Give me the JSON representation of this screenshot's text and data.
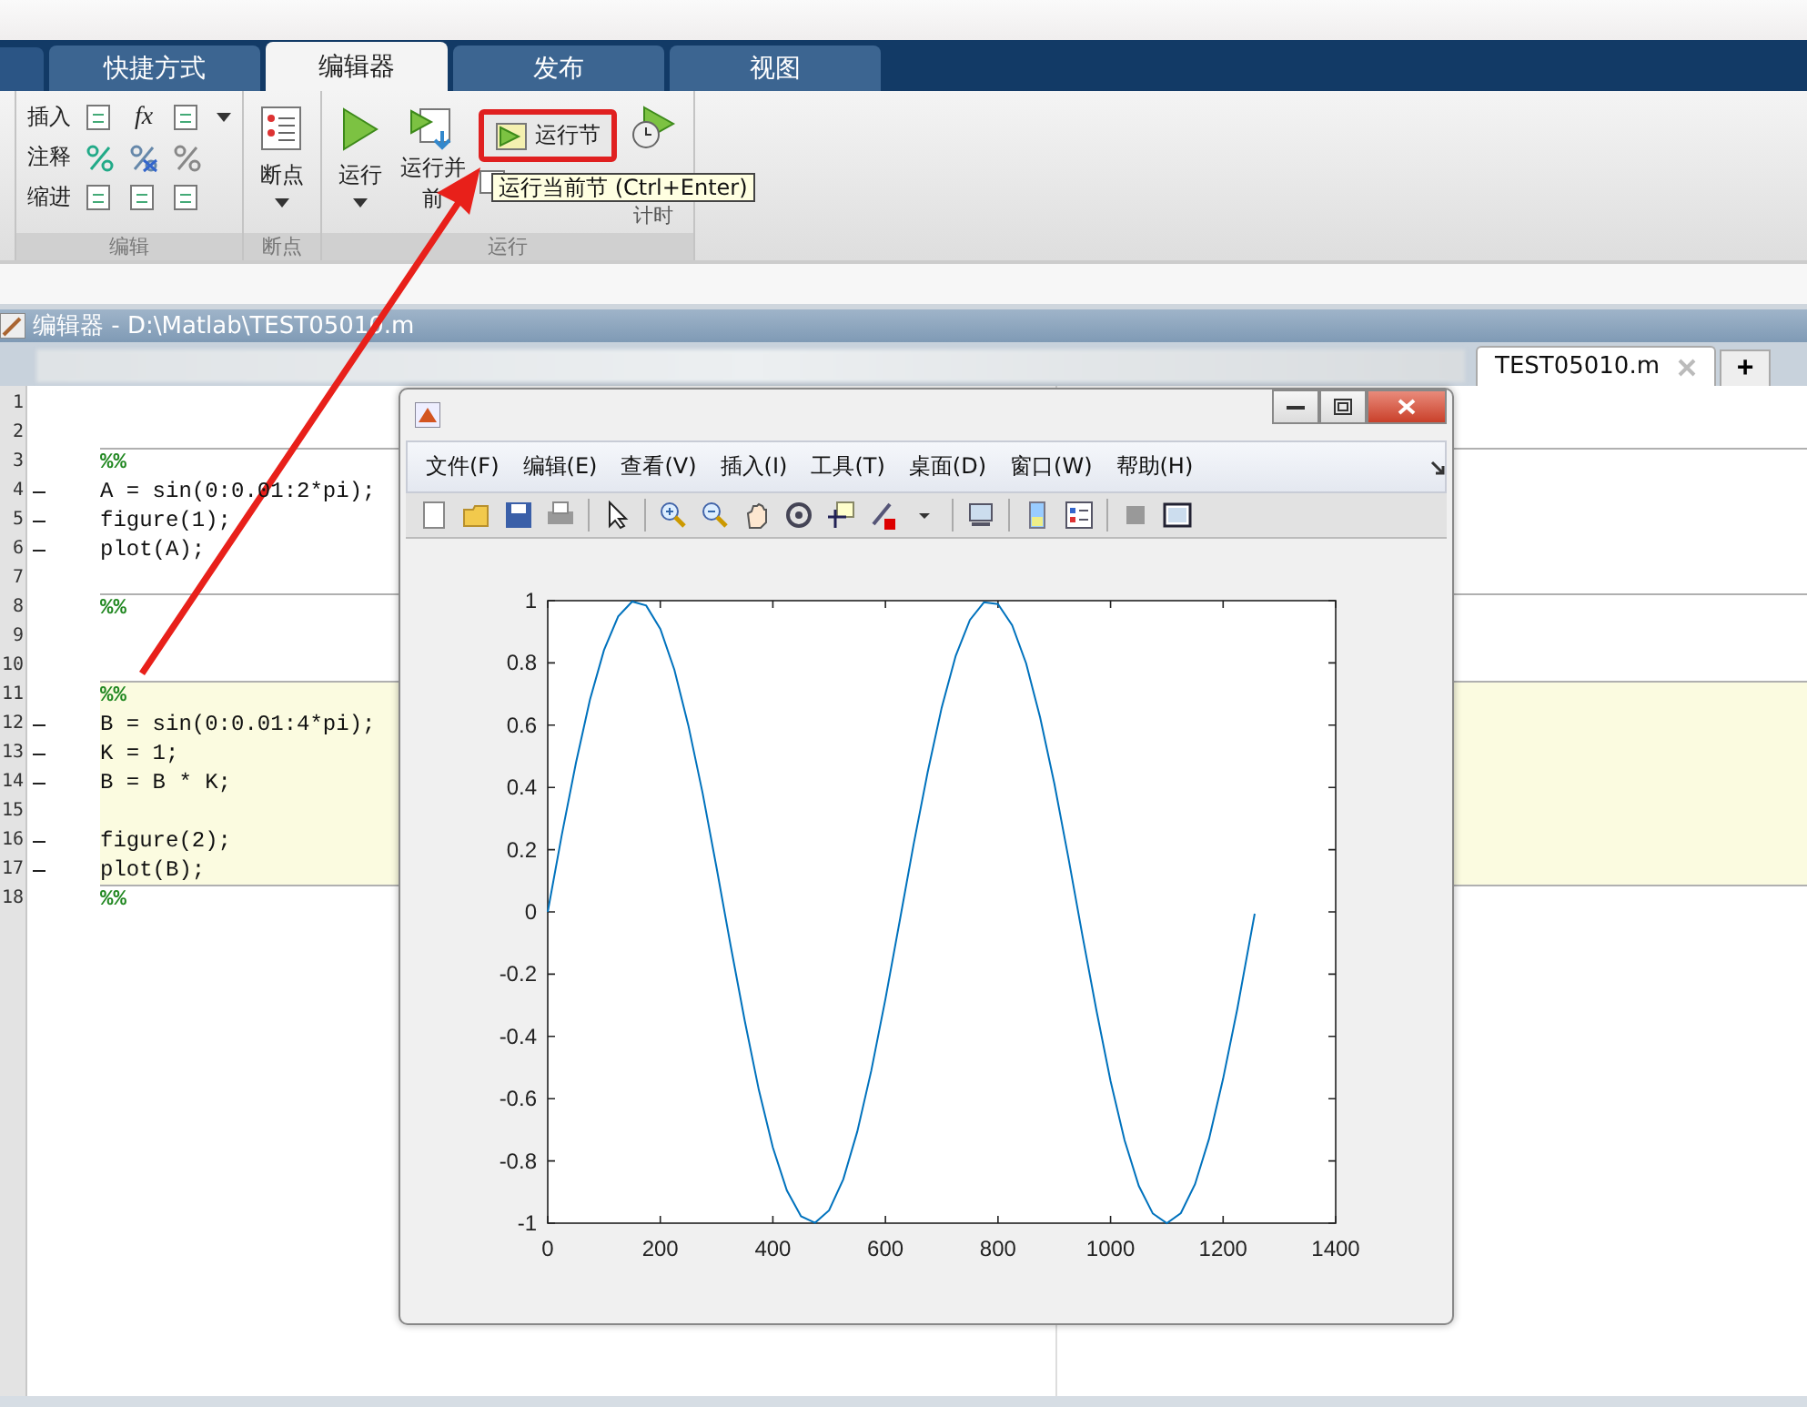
{
  "ribbon_tabs": [
    {
      "label": "快捷方式",
      "selected": false
    },
    {
      "label": "编辑器",
      "selected": true
    },
    {
      "label": "发布",
      "selected": false
    },
    {
      "label": "视图",
      "selected": false
    }
  ],
  "ribbon": {
    "edit_group": {
      "title": "编辑",
      "rows": [
        "插入",
        "注释",
        "缩进"
      ]
    },
    "function_glyph": "fx",
    "breakpoint_group": {
      "title": "断点",
      "button": "断点"
    },
    "run_group": {
      "title": "运行",
      "run": "运行",
      "run_advance": [
        "运行并",
        "前"
      ],
      "run_section": {
        "label": "运行节",
        "highlighted": true
      },
      "run_time": "计时"
    }
  },
  "tooltip": "运行当前节 (Ctrl+Enter)",
  "editor": {
    "title": "编辑器 - D:\\Matlab\\TEST05010.m",
    "file_tab": "TEST05010.m",
    "add_tab": "+",
    "lines": [
      {
        "number": "1",
        "kind": "blank",
        "executable": false,
        "section_start": false,
        "current_section": false
      },
      {
        "number": "2",
        "kind": "blank",
        "executable": false,
        "section_start": false,
        "current_section": false
      },
      {
        "number": "3",
        "kind": "section",
        "code": "%%",
        "executable": false,
        "section_start": true,
        "current_section": false
      },
      {
        "number": "4",
        "kind": "code",
        "code": "A = sin(0:0.01:2*pi);",
        "executable": true,
        "section_start": false,
        "current_section": false
      },
      {
        "number": "5",
        "kind": "code",
        "code": "figure(1);",
        "executable": true,
        "section_start": false,
        "current_section": false
      },
      {
        "number": "6",
        "kind": "code",
        "code": "plot(A);",
        "executable": true,
        "section_start": false,
        "current_section": false
      },
      {
        "number": "7",
        "kind": "blank",
        "executable": false,
        "section_start": false,
        "current_section": false
      },
      {
        "number": "8",
        "kind": "section",
        "code": "%%",
        "executable": false,
        "section_start": true,
        "current_section": false
      },
      {
        "number": "9",
        "kind": "blank",
        "executable": false,
        "section_start": false,
        "current_section": false
      },
      {
        "number": "10",
        "kind": "blank",
        "executable": false,
        "section_start": false,
        "current_section": false
      },
      {
        "number": "11",
        "kind": "section",
        "code": "%%",
        "executable": false,
        "section_start": true,
        "current_section": true
      },
      {
        "number": "12",
        "kind": "code",
        "code": "B = sin(0:0.01:4*pi);",
        "executable": true,
        "section_start": false,
        "current_section": true
      },
      {
        "number": "13",
        "kind": "code",
        "code": "K = 1;",
        "executable": true,
        "section_start": false,
        "current_section": true
      },
      {
        "number": "14",
        "kind": "code",
        "code": "B = B * K;",
        "executable": true,
        "section_start": false,
        "current_section": true
      },
      {
        "number": "15",
        "kind": "blank",
        "executable": false,
        "section_start": false,
        "current_section": true
      },
      {
        "number": "16",
        "kind": "code",
        "code": "figure(2);",
        "executable": true,
        "section_start": false,
        "current_section": true
      },
      {
        "number": "17",
        "kind": "code",
        "code": "plot(B);",
        "executable": true,
        "section_start": false,
        "current_section": true
      },
      {
        "number": "18",
        "kind": "section",
        "code": "%%",
        "executable": false,
        "section_start": true,
        "current_section": false
      }
    ]
  },
  "figure": {
    "menu": [
      "文件(F)",
      "编辑(E)",
      "查看(V)",
      "插入(I)",
      "工具(T)",
      "桌面(D)",
      "窗口(W)",
      "帮助(H)"
    ],
    "chart_data": {
      "type": "line",
      "xlim": [
        0,
        1400
      ],
      "ylim": [
        -1,
        1
      ],
      "xticks": [
        0,
        200,
        400,
        600,
        800,
        1000,
        1200,
        1400
      ],
      "yticks": [
        -1,
        -0.8,
        -0.6,
        -0.4,
        -0.2,
        0,
        0.2,
        0.4,
        0.6,
        0.8,
        1
      ],
      "x": [
        0,
        25,
        50,
        75,
        100,
        125,
        150,
        175,
        200,
        225,
        250,
        275,
        300,
        325,
        350,
        375,
        400,
        425,
        450,
        475,
        500,
        525,
        550,
        575,
        600,
        625,
        650,
        675,
        700,
        725,
        750,
        775,
        800,
        825,
        850,
        875,
        900,
        925,
        950,
        975,
        1000,
        1025,
        1050,
        1075,
        1100,
        1125,
        1150,
        1175,
        1200,
        1225,
        1250,
        1256
      ],
      "series": [
        {
          "color": "#0072bd",
          "values": [
            0,
            0.247,
            0.479,
            0.682,
            0.841,
            0.949,
            0.997,
            0.984,
            0.909,
            0.778,
            0.598,
            0.382,
            0.141,
            -0.108,
            -0.351,
            -0.572,
            -0.757,
            -0.895,
            -0.978,
            -0.999,
            -0.959,
            -0.859,
            -0.706,
            -0.51,
            -0.279,
            -0.033,
            0.215,
            0.45,
            0.657,
            0.823,
            0.938,
            0.995,
            0.989,
            0.921,
            0.798,
            0.624,
            0.412,
            0.174,
            -0.075,
            -0.319,
            -0.544,
            -0.734,
            -0.88,
            -0.969,
            -1,
            -0.968,
            -0.875,
            -0.729,
            -0.537,
            -0.313,
            -0.066,
            -0.006
          ]
        }
      ]
    }
  }
}
